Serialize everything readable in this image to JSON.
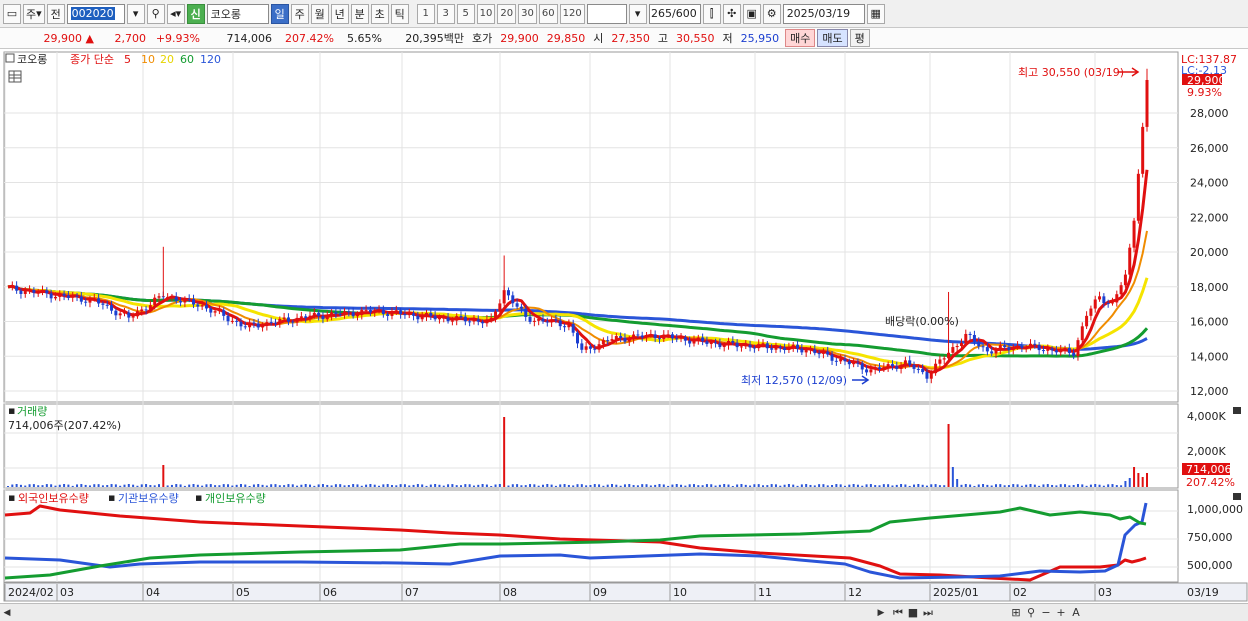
{
  "toolbar": {
    "period_short": "주",
    "prev_label": "전",
    "code": "002020",
    "new_badge": "신",
    "stock_name": "코오롱",
    "tabs": [
      "일",
      "주",
      "월",
      "년",
      "분",
      "초",
      "틱"
    ],
    "active_tab": "일",
    "periods": [
      "1",
      "3",
      "5",
      "10",
      "20",
      "30",
      "60",
      "120"
    ],
    "count": "265",
    "count_total": "/600",
    "date": "2025/03/19"
  },
  "quote": {
    "price": "29,900",
    "change": "2,700",
    "change_pct": "+9.93%",
    "volume": "714,006",
    "volume_pct": "207.42%",
    "turnover": "5.65%",
    "amount": "20,395백만",
    "bid_label": "호가",
    "ask": "29,900",
    "bid": "29,850",
    "open_label": "시",
    "open": "27,350",
    "high_label": "고",
    "high": "30,550",
    "low_label": "저",
    "low": "25,950",
    "buy_label": "매수",
    "sell_label": "매도",
    "eval_label": "평"
  },
  "price_panel": {
    "name": "코오롱",
    "legend_title": "종가 단순",
    "ma_labels": [
      "5",
      "10",
      "20",
      "60",
      "120"
    ],
    "ma_colors": [
      "#e01010",
      "#f08c00",
      "#f5e400",
      "#149c30",
      "#2a55d8"
    ],
    "y_ticks": [
      "28,000",
      "26,000",
      "24,000",
      "22,000",
      "20,000",
      "18,000",
      "16,000",
      "14,000",
      "12,000"
    ],
    "lc_top": "LC:137.87",
    "lc_bottom": "LC:-2.13",
    "last_price": "29,900",
    "last_pct": "9.93%",
    "high_note": "최고 30,550 (03/19)",
    "low_note": "최저 12,570 (12/09)",
    "dividend_note": "배당락(0.00%)"
  },
  "volume_panel": {
    "title": "거래량",
    "value_label": "714,006주(207.42%)",
    "y_ticks": [
      "4,000K",
      "2,000K"
    ],
    "last_value": "714,006",
    "last_pct": "207.42%"
  },
  "holding_panel": {
    "series_labels": [
      "외국인보유수량",
      "기관보유수량",
      "개인보유수량"
    ],
    "series_colors": [
      "#e01010",
      "#2a55d8",
      "#149c30"
    ],
    "y_ticks": [
      "1,000,000",
      "750,000",
      "500,000"
    ]
  },
  "x_axis": {
    "labels": [
      "2024/02",
      "03",
      "04",
      "05",
      "06",
      "07",
      "08",
      "09",
      "10",
      "11",
      "12",
      "2025/01",
      "02",
      "03"
    ],
    "right_label": "03/19"
  }
}
